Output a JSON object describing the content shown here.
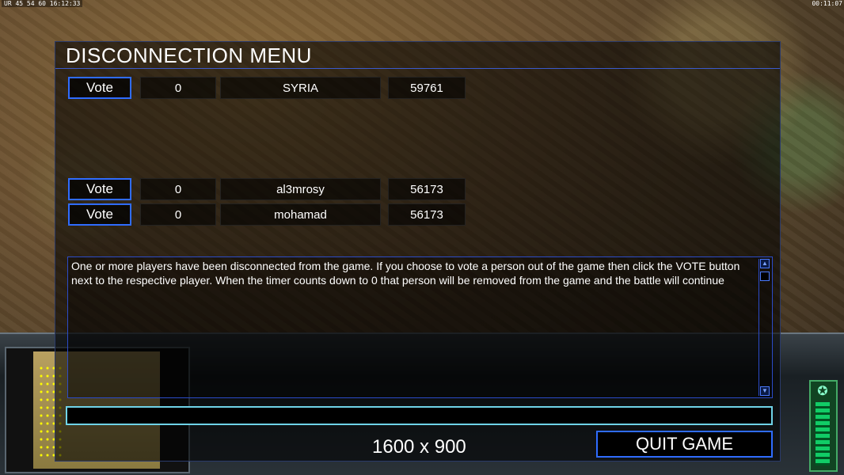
{
  "hud": {
    "top_left": "UR 45 54 60 16:12:33",
    "top_right": "00:11:07"
  },
  "dialog": {
    "title": "DISCONNECTION MENU",
    "vote_label": "Vote",
    "players": [
      {
        "count": "0",
        "name": "SYRIA",
        "ping": "59761"
      },
      {
        "count": "0",
        "name": "al3mrosy",
        "ping": "56173"
      },
      {
        "count": "0",
        "name": "mohamad",
        "ping": "56173"
      }
    ],
    "message": "One or more players have been disconnected from the game. If you choose to vote a person out of the game then click the VOTE button next to the respective player. When the timer counts down to 0 that person will be removed from the game and the battle will continue",
    "chat_value": "",
    "resolution": "1600 x 900",
    "quit_label": "QUIT GAME"
  },
  "colors": {
    "button_border": "#2f6cff",
    "chat_border": "#6fd3e8",
    "title_rule": "#3a5acc"
  }
}
